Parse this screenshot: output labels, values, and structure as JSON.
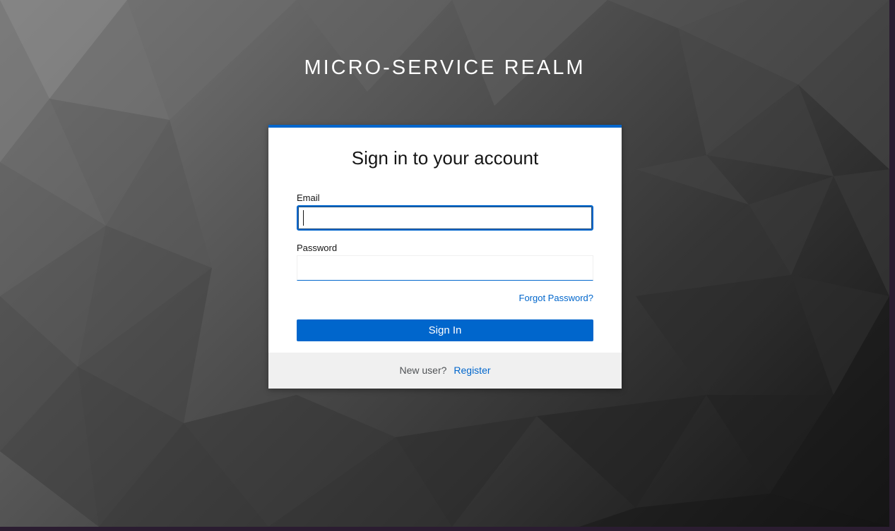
{
  "realm": {
    "title": "MICRO-SERVICE REALM"
  },
  "login": {
    "title": "Sign in to your account",
    "email_label": "Email",
    "email_value": "",
    "password_label": "Password",
    "password_value": "",
    "forgot_password": "Forgot Password?",
    "submit": "Sign In"
  },
  "footer": {
    "new_user_text": "New user?",
    "register_link": "Register"
  },
  "colors": {
    "accent": "#0066cc",
    "footer_bg": "#f0f0f0",
    "text": "#151515"
  }
}
